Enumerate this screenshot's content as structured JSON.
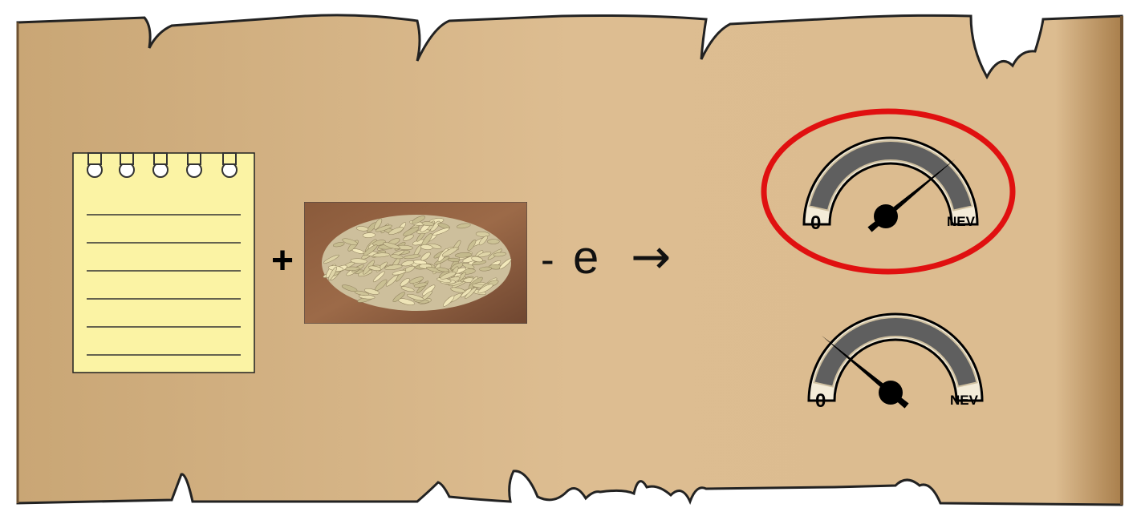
{
  "equation": {
    "plus": "+",
    "minus": "-",
    "letter": "e",
    "arrow": "→"
  },
  "gauges": [
    {
      "min_label": "0",
      "max_label": "NEV",
      "level": 0.78,
      "highlighted": true
    },
    {
      "min_label": "0",
      "max_label": "NEV",
      "level": 0.22,
      "highlighted": false
    }
  ],
  "colors": {
    "parchment": "#d9b98c",
    "parchment_edge": "#a9834f",
    "notepad": "#fbf3a4",
    "gauge_band": "#5f5f5f",
    "highlight_ring": "#e01010"
  },
  "icons": [
    "notepad-icon",
    "oat-grains-image",
    "gauge-icon"
  ]
}
